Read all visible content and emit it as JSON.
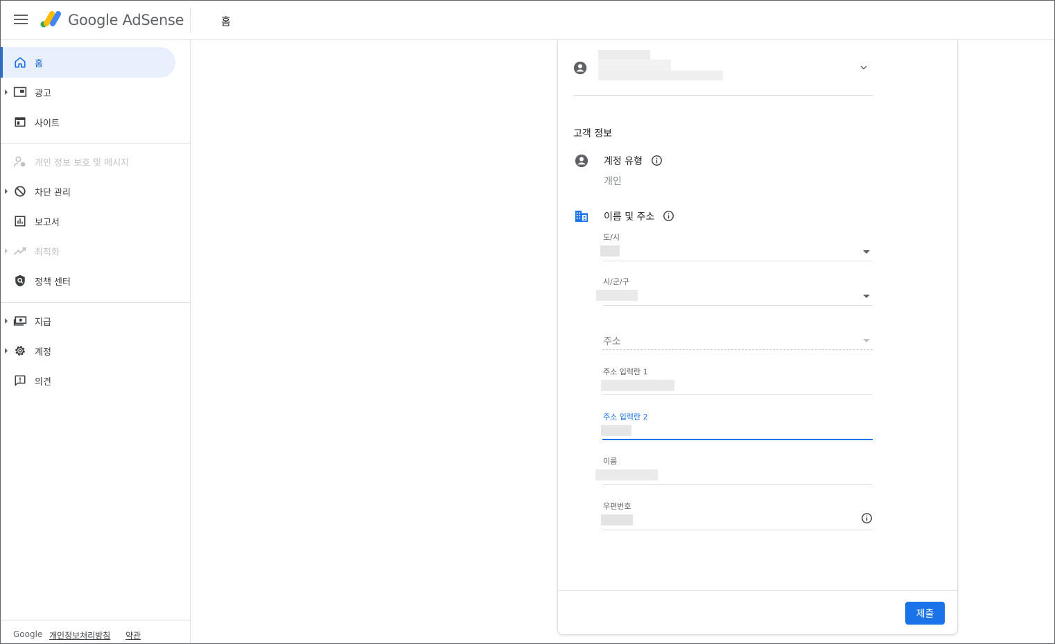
{
  "header": {
    "brand": "Google AdSense",
    "page_title": "홈"
  },
  "sidebar": {
    "items": [
      {
        "label": "홈",
        "icon": "home-icon",
        "active": true
      },
      {
        "label": "광고",
        "icon": "ads-icon"
      },
      {
        "label": "사이트",
        "icon": "sites-icon"
      },
      {
        "label": "개인 정보 보호 및 메시지",
        "icon": "privacy-messaging-icon",
        "disabled": true
      },
      {
        "label": "차단 관리",
        "icon": "block-icon"
      },
      {
        "label": "보고서",
        "icon": "reports-icon"
      },
      {
        "label": "최적화",
        "icon": "optimize-icon",
        "disabled": true
      },
      {
        "label": "정책 센터",
        "icon": "policy-shield-icon"
      },
      {
        "label": "지급",
        "icon": "payments-icon"
      },
      {
        "label": "계정",
        "icon": "gear-icon"
      },
      {
        "label": "의견",
        "icon": "feedback-icon"
      }
    ],
    "footer": {
      "google": "Google",
      "privacy": "개인정보처리방침",
      "terms": "약관"
    }
  },
  "form": {
    "section_title": "고객 정보",
    "account_type": {
      "label": "계정 유형",
      "value": "개인"
    },
    "name_address": {
      "label": "이름 및 주소"
    },
    "fields": {
      "province": {
        "label": "도/시"
      },
      "city": {
        "label": "시/군/구"
      },
      "address": {
        "placeholder": "주소"
      },
      "address1": {
        "label": "주소 입력란 1"
      },
      "address2": {
        "label": "주소 입력란 2"
      },
      "name": {
        "label": "이름"
      },
      "postal": {
        "label": "우편번호"
      }
    },
    "submit_label": "제출"
  },
  "colors": {
    "accent": "#1a73e8",
    "active_bg": "#e8f0fe"
  }
}
